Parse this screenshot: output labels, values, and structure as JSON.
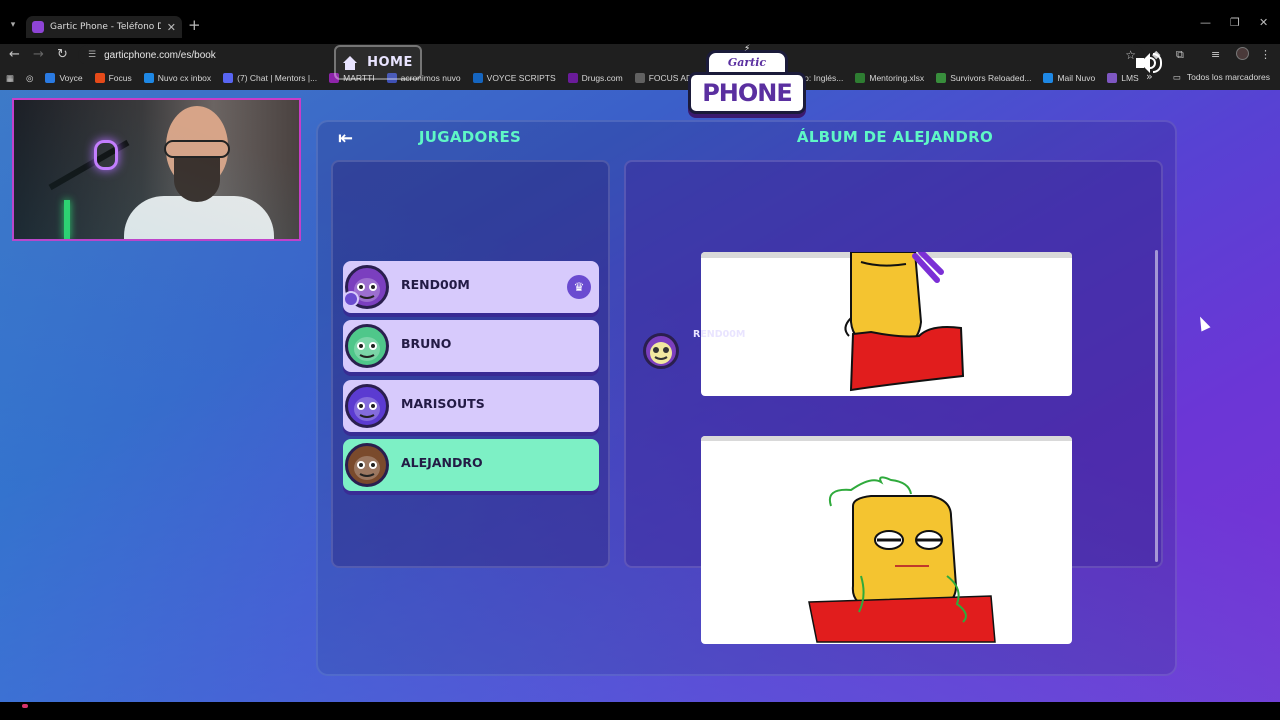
{
  "browser": {
    "tab_title": "Gartic Phone - Teléfono Descon",
    "url": "garticphone.com/es/book",
    "bookmarks": [
      {
        "label": "Voyce",
        "color": "#2a7ae2"
      },
      {
        "label": "Focus",
        "color": "#e64a19"
      },
      {
        "label": "Nuvo cx inbox",
        "color": "#1e88e5"
      },
      {
        "label": "(7) Chat | Mentors |...",
        "color": "#5865f2"
      },
      {
        "label": "MARTTI",
        "color": "#8e24aa"
      },
      {
        "label": "acronimos nuvo",
        "color": "#3f51b5"
      },
      {
        "label": "VOYCE SCRIPTS",
        "color": "#1565c0"
      },
      {
        "label": "Drugs.com",
        "color": "#6a1b9a"
      },
      {
        "label": "FOCUS ADJUSTME...",
        "color": "#616161"
      },
      {
        "label": "Inglés básico: Inglés...",
        "color": "#616161"
      },
      {
        "label": "Mentoring.xlsx",
        "color": "#2e7d32"
      },
      {
        "label": "Survivors Reloaded...",
        "color": "#388e3c"
      },
      {
        "label": "Mail Nuvo",
        "color": "#1e88e5"
      },
      {
        "label": "LMS",
        "color": "#7e57c2"
      }
    ],
    "all_bookmarks": "Todos los marcadores"
  },
  "game": {
    "home_label": "HOME",
    "logo_top": "Gartic",
    "logo_bottom": "PHONE",
    "players_title": "JUGADORES",
    "album_title": "ÁLBUM DE ALEJANDRO",
    "players": [
      {
        "name": "REND00M",
        "owner": true,
        "active": false,
        "avatar_color": "#7b3fbf"
      },
      {
        "name": "BRUNO",
        "owner": false,
        "active": false,
        "avatar_color": "#4fc78a"
      },
      {
        "name": "MARISOUTS",
        "owner": false,
        "active": false,
        "avatar_color": "#5b3bd1"
      },
      {
        "name": "ALEJANDRO",
        "owner": false,
        "active": true,
        "avatar_color": "#7a4a2c"
      }
    ],
    "album_author": "REND00M",
    "colors": {
      "accent_green": "#5ff7c6",
      "player_card": "#d7cafc",
      "player_active": "#7df0c5",
      "drawing_red": "#e11d1d",
      "drawing_yellow": "#f4c430"
    }
  }
}
